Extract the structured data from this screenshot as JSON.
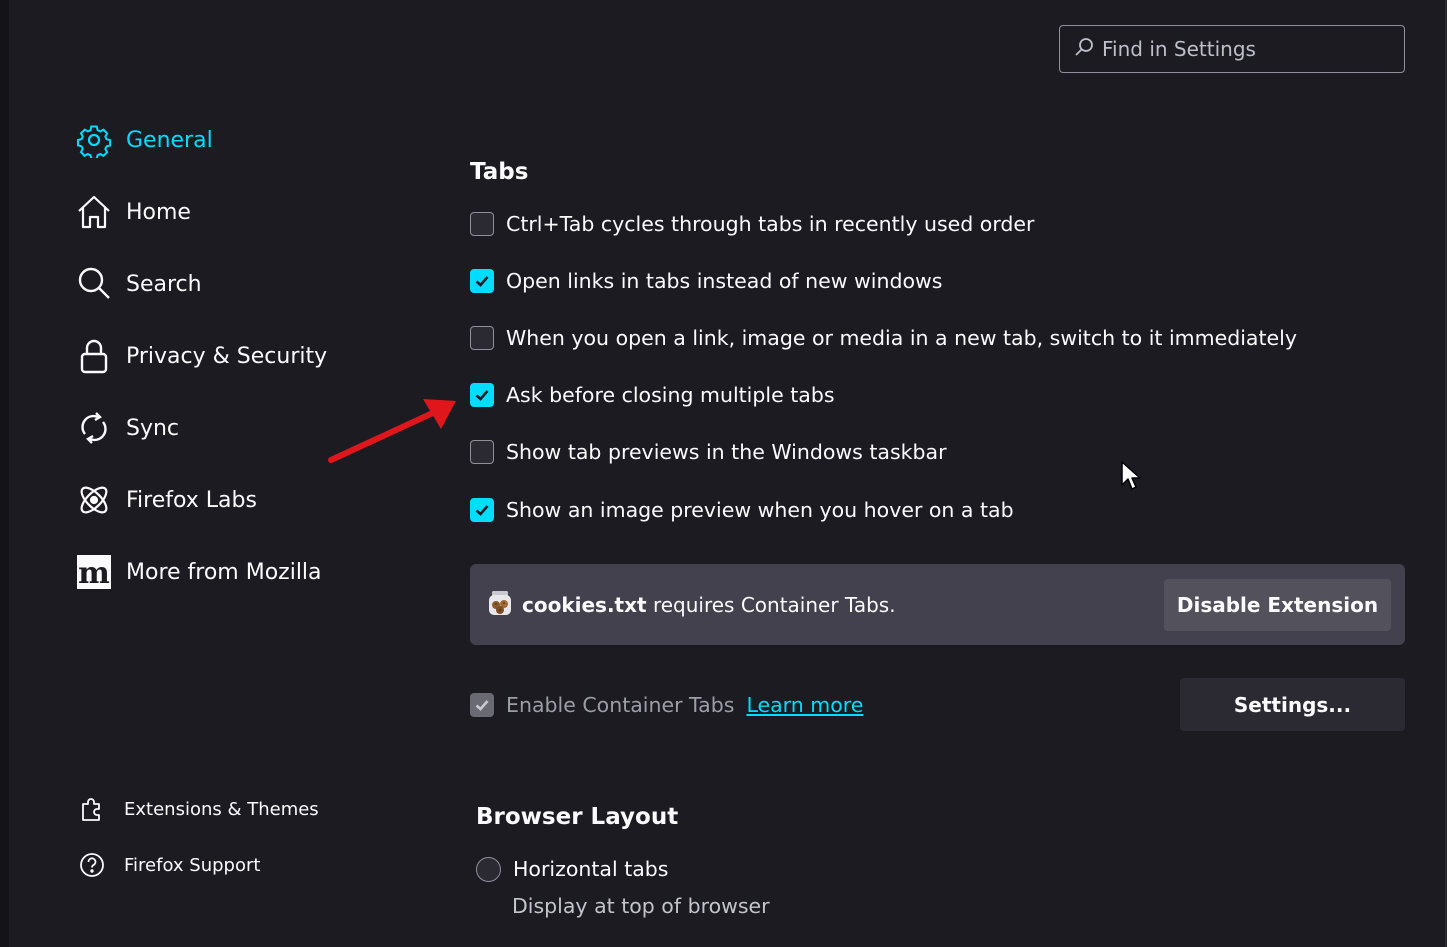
{
  "search": {
    "placeholder": "Find in Settings",
    "icon": "search-icon"
  },
  "sidebar": {
    "items": [
      {
        "label": "General",
        "icon": "gear-icon",
        "selected": true
      },
      {
        "label": "Home",
        "icon": "home-icon"
      },
      {
        "label": "Search",
        "icon": "magnifier-icon"
      },
      {
        "label": "Privacy & Security",
        "icon": "lock-icon"
      },
      {
        "label": "Sync",
        "icon": "sync-icon"
      },
      {
        "label": "Firefox Labs",
        "icon": "atom-icon"
      },
      {
        "label": "More from Mozilla",
        "icon": "mozilla-m-icon"
      }
    ],
    "footer": [
      {
        "label": "Extensions & Themes",
        "icon": "puzzle-icon"
      },
      {
        "label": "Firefox Support",
        "icon": "help-icon"
      }
    ]
  },
  "tabs": {
    "title": "Tabs",
    "options": [
      {
        "label": "Ctrl+Tab cycles through tabs in recently used order",
        "checked": false
      },
      {
        "label": "Open links in tabs instead of new windows",
        "checked": true
      },
      {
        "label": "When you open a link, image or media in a new tab, switch to it immediately",
        "checked": false
      },
      {
        "label": "Ask before closing multiple tabs",
        "checked": true
      },
      {
        "label": "Show tab previews in the Windows taskbar",
        "checked": false
      },
      {
        "label": "Show an image preview when you hover on a tab",
        "checked": true
      }
    ]
  },
  "notice": {
    "extension_name": "cookies.txt",
    "message": " requires Container Tabs.",
    "button": "Disable Extension"
  },
  "containers": {
    "label": "Enable Container Tabs",
    "checked": true,
    "disabled": true,
    "learn_more": "Learn more",
    "settings_button": "Settings..."
  },
  "browser_layout": {
    "title": "Browser Layout",
    "option_label": "Horizontal tabs",
    "option_desc": "Display at top of browser"
  },
  "colors": {
    "accent": "#00ddff",
    "background": "#1c1b22",
    "panel": "#42414d",
    "annotation_arrow": "#e0161d"
  }
}
